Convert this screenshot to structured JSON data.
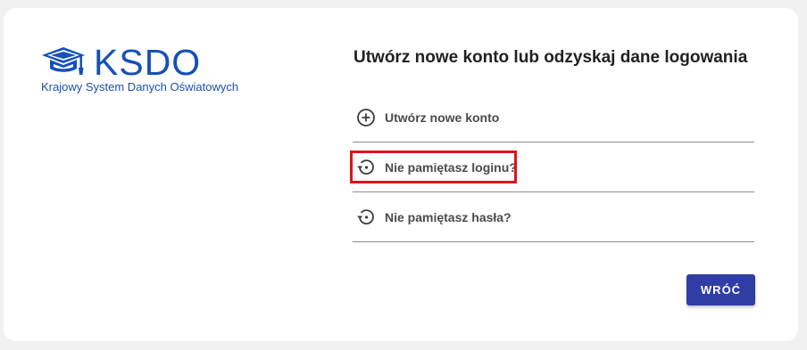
{
  "brand": {
    "title": "KSDO",
    "subtitle": "Krajowy System Danych Oświatowych",
    "icon": "graduation-cap-icon",
    "color": "#1650b8"
  },
  "panel": {
    "heading": "Utwórz nowe konto lub odzyskaj dane logowania",
    "options": [
      {
        "label": "Utwórz nowe konto",
        "icon": "add-circle-icon"
      },
      {
        "label": "Nie pamiętasz loginu?",
        "icon": "restore-icon",
        "highlighted": true
      },
      {
        "label": "Nie pamiętasz hasła?",
        "icon": "restore-icon"
      }
    ]
  },
  "actions": {
    "back_label": "WRÓĆ",
    "back_color": "#2f3da4"
  },
  "highlight_color": "#e0131b"
}
